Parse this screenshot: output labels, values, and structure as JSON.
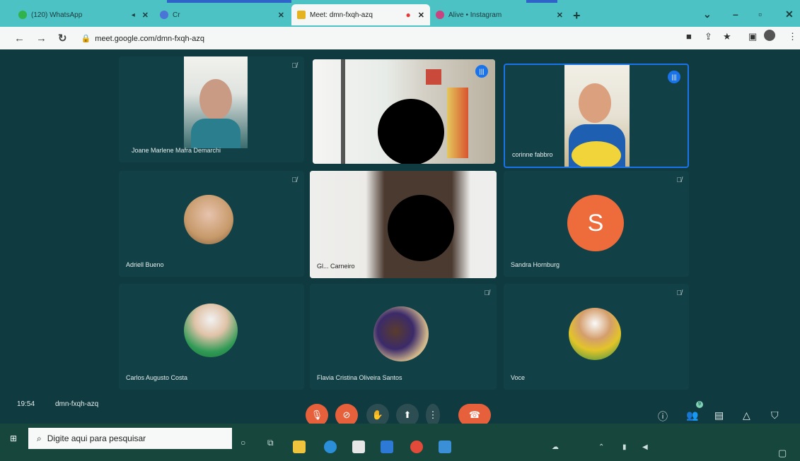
{
  "browser": {
    "tabs": [
      {
        "title": "(120) WhatsApp",
        "active": false
      },
      {
        "title": "Cr",
        "active": false
      },
      {
        "title": "Meet: dmn-fxqh-azq",
        "active": true
      },
      {
        "title": "Alive • Instagram",
        "active": false
      }
    ],
    "new_tab": "+",
    "url": "meet.google.com/dmn-fxqh-azq",
    "colors": {
      "tabstrip": "#4cc2c4",
      "meet_bg": "#0f3a3f",
      "accent_red": "#e7603c",
      "speaking_blue": "#1a73e8"
    }
  },
  "participants": [
    {
      "name": "Joane Marlene Mafra Demarchi",
      "type": "video",
      "muted": true
    },
    {
      "name": "",
      "type": "video",
      "speaking": true
    },
    {
      "name": "corinne fabbro",
      "type": "video",
      "speaking": true
    },
    {
      "name": "Adriell Bueno",
      "type": "avatar",
      "muted": true
    },
    {
      "name": "Gl... Carneiro",
      "type": "video"
    },
    {
      "name": "Sandra Hornburg",
      "type": "letter",
      "letter": "S",
      "muted": true
    },
    {
      "name": "Carlos Augusto Costa",
      "type": "avatar"
    },
    {
      "name": "Flavia Cristina Oliveira Santos",
      "type": "avatar",
      "muted": true
    },
    {
      "name": "Voce",
      "type": "avatar",
      "muted": true
    }
  ],
  "meeting": {
    "time": "19:54",
    "code": "dmn-fxqh-azq"
  },
  "controls": {
    "participants_count": "9"
  },
  "taskbar": {
    "search_placeholder": "Digite aqui para pesquisar"
  }
}
